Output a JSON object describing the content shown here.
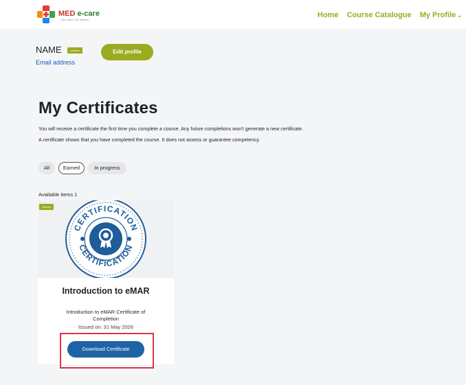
{
  "logo": {
    "brand_med": "MED",
    "brand_ecare": "e-care",
    "tagline": "Your Care. Our Mission"
  },
  "nav": {
    "home": "Home",
    "catalogue": "Course Catalogue",
    "profile": "My Profile",
    "profile_caret": "⌄"
  },
  "profile": {
    "name": "NAME",
    "role_badge": "Learner",
    "email": "Email address",
    "edit_button": "Edit profile"
  },
  "page": {
    "title": "My Certificates",
    "description_line1": "You will receive a certificate the first time you complete a course. Any future completions won't generate a new certificate.",
    "description_line2": "A certificate shows that you have completed the course. It does not assess or guarantee competency."
  },
  "filters": {
    "all": "All",
    "earned": "Earned",
    "in_progress": "In progress",
    "selected": "Earned"
  },
  "results": {
    "available_label": "Available items 1"
  },
  "card": {
    "badge": "Earned",
    "seal_text_top": "CERTIFICATION",
    "seal_text_bottom": "CERTIFICATION",
    "course_title": "Introduction to eMAR",
    "certificate_name": "Introduction to eMAR Certificate of Completion",
    "issued": "Issued on: 31 May 2026",
    "download_button": "Download Certificate"
  },
  "colors": {
    "accent_olive": "#9aab1f",
    "primary_blue": "#1e63a6",
    "seal_blue": "#1f5c99",
    "highlight_red": "#d9363e"
  }
}
